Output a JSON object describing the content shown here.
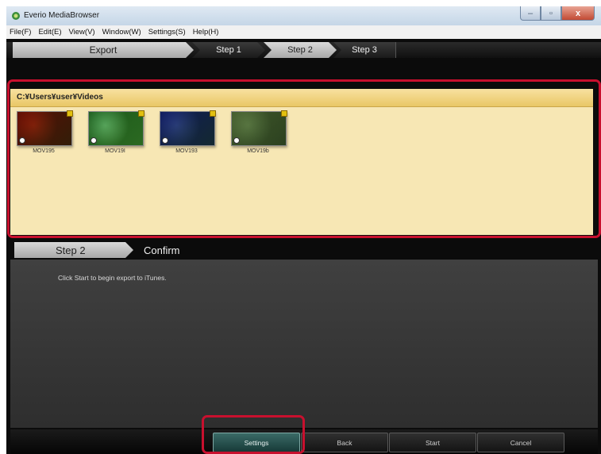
{
  "window": {
    "title": "Everio MediaBrowser",
    "controls": {
      "minimize": "–",
      "maximize": "▫",
      "close": "x"
    }
  },
  "menu": [
    "File(F)",
    "Edit(E)",
    "View(V)",
    "Window(W)",
    "Settings(S)",
    "Help(H)"
  ],
  "steps": {
    "export": "Export",
    "step1": "Step 1",
    "step2": "Step 2",
    "step3": "Step 3"
  },
  "folder": {
    "path": "C:¥Users¥user¥Videos",
    "thumbnails": [
      {
        "label": "MOV195",
        "colors": [
          "#6a2a18",
          "#b2462a",
          "#3d5a2a"
        ]
      },
      {
        "label": "MOV19I",
        "colors": [
          "#3b6a3a",
          "#9ab8b4",
          "#5e7f4a"
        ]
      },
      {
        "label": "MOV193",
        "colors": [
          "#2c3a6a",
          "#6a6fa8",
          "#3a5a3a"
        ]
      },
      {
        "label": "MOV19b",
        "colors": [
          "#5a6a4a",
          "#8a9a7a",
          "#3e4e36"
        ]
      }
    ]
  },
  "confirm": {
    "step_label": "Step 2",
    "title": "Confirm",
    "message": "Click Start to begin export to iTunes."
  },
  "buttons": {
    "settings": "Settings",
    "back": "Back",
    "start": "Start",
    "cancel": "Cancel"
  },
  "colors": {
    "highlight": "#c8102e",
    "folder_bg": "#f7e7b4"
  }
}
